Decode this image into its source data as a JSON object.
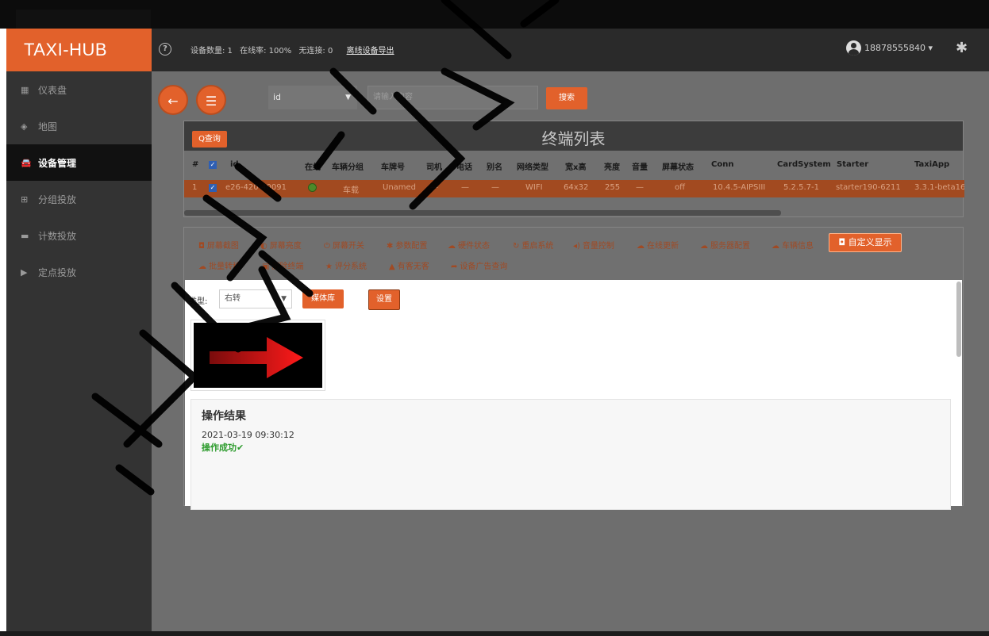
{
  "header": {
    "logo": "TAXI-HUB",
    "stats": {
      "device_count": "设备数量: 1",
      "online_rate": "在线率: 100%",
      "no_connection": "无连接: 0",
      "export_link": "离线设备导出"
    },
    "user": "18878555840 ▾"
  },
  "sidebar": {
    "items": [
      {
        "label": "仪表盘",
        "icon": "dashboard-icon"
      },
      {
        "label": "地图",
        "icon": "map-icon"
      },
      {
        "label": "设备管理",
        "icon": "car-icon"
      },
      {
        "label": "分组投放",
        "icon": "group-icon"
      },
      {
        "label": "计数投放",
        "icon": "counter-icon"
      },
      {
        "label": "定点投放",
        "icon": "play-icon"
      }
    ]
  },
  "search": {
    "field_value": "id",
    "placeholder": "请输入内容",
    "button": "搜索"
  },
  "terminal_panel": {
    "query_button": "Q查询",
    "title": "终端列表",
    "columns": [
      "#",
      "id",
      "在线",
      "车辆分组",
      "车牌号",
      "司机",
      "电话",
      "别名",
      "网络类型",
      "宽x高",
      "亮度",
      "音量",
      "屏幕状态",
      "Conn",
      "CardSystem",
      "Starter",
      "TaxiApp"
    ],
    "row": {
      "index": "1",
      "id": "e26-420-40091",
      "group": "车载",
      "plate": "Unamed",
      "driver": "—",
      "phone": "—",
      "alias": "—",
      "network": "WIFI",
      "size": "64x32",
      "brightness": "255",
      "volume": "—",
      "screen_state": "off",
      "conn": "10.4.5-AIPSIII",
      "card_system": "5.2.5.7-1",
      "starter": "starter190-6211",
      "taxi_app": "3.3.1-beta16"
    }
  },
  "actions": {
    "row1": [
      "屏幕截图",
      "屏幕亮度",
      "屏幕开关",
      "参数配置",
      "硬件状态",
      "重启系统",
      "音量控制",
      "在线更新",
      "服务器配置",
      "车辆信息"
    ],
    "custom_display": "自定义显示",
    "row2": [
      "批量转移",
      "删除终端",
      "评分系统",
      "有客无客",
      "设备广告查询"
    ]
  },
  "custom": {
    "type_label": "类型:",
    "type_value": "右转",
    "media_button": "媒体库",
    "settings_button": "设置"
  },
  "result": {
    "title": "操作结果",
    "time": "2021-03-19 09:30:12",
    "status": "操作成功✔"
  },
  "colors": {
    "accent": "#e2612b",
    "header": "#2a2a2a",
    "sidebar": "#333333",
    "success": "#2c9b2c"
  }
}
